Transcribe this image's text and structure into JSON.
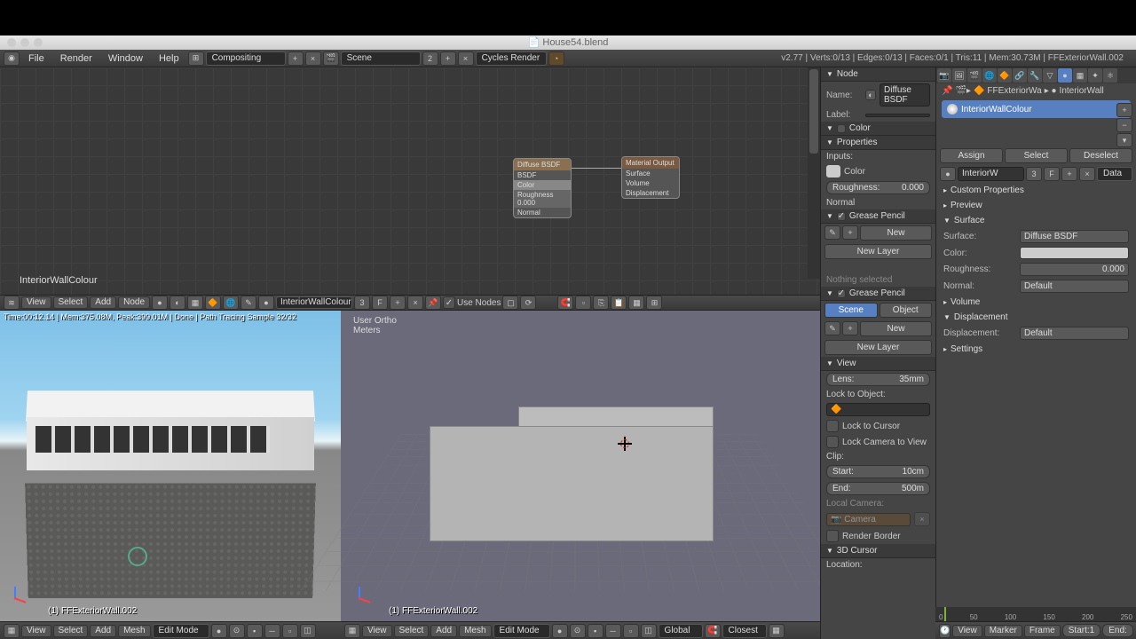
{
  "title": "House54.blend",
  "topmenu": {
    "file": "File",
    "render": "Render",
    "window": "Window",
    "help": "Help",
    "layout": "Compositing",
    "scene": "Scene",
    "engine": "Cycles Render",
    "stats": "v2.77 | Verts:0/13 | Edges:0/13 | Faces:0/1 | Tris:11 | Mem:30.73M | FFExteriorWall.002"
  },
  "node_editor": {
    "material_label": "InteriorWallColour",
    "node1_title": "Diffuse BSDF",
    "node1_color": "Color",
    "node1_rough": "Roughness 0.000",
    "node2_title": "Material Output",
    "node2_surface": "Surface",
    "node2_volume": "Volume",
    "node2_disp": "Displacement"
  },
  "node_header": {
    "view": "View",
    "select": "Select",
    "add": "Add",
    "node": "Node",
    "material": "InteriorWallColour",
    "use_nodes": "Use Nodes",
    "f": "F"
  },
  "render_view": {
    "stats": "Time:00:12.14 | Mem:375.08M, Peak:399.01M | Done | Path Tracing Sample 32/32",
    "object": "(1) FFExteriorWall.002"
  },
  "edit_view": {
    "proj": "User Ortho",
    "units": "Meters",
    "object": "(1) FFExteriorWall.002"
  },
  "footer_left": {
    "view": "View",
    "select": "Select",
    "add": "Add",
    "mesh": "Mesh",
    "mode": "Edit Mode"
  },
  "footer_right": {
    "view": "View",
    "select": "Select",
    "add": "Add",
    "mesh": "Mesh",
    "mode": "Edit Mode",
    "global": "Global"
  },
  "npanel": {
    "node_hdr": "Node",
    "name_lbl": "Name:",
    "name_val": "Diffuse BSDF",
    "label_lbl": "Label:",
    "label_val": "",
    "color_hdr": "Color",
    "props_hdr": "Properties",
    "inputs": "Inputs:",
    "color_inp": "Color",
    "rough_lbl": "Roughness:",
    "rough_val": "0.000",
    "normal": "Normal",
    "gp_hdr": "Grease Pencil",
    "new": "New",
    "newlayer": "New Layer",
    "nothing": "Nothing selected",
    "scene": "Scene",
    "object": "Object",
    "view_hdr": "View",
    "lens_lbl": "Lens:",
    "lens_val": "35mm",
    "lock_obj": "Lock to Object:",
    "lock_cursor": "Lock to Cursor",
    "lock_cam": "Lock Camera to View",
    "clip": "Clip:",
    "start_lbl": "Start:",
    "start_val": "10cm",
    "end_lbl": "End:",
    "end_val": "500m",
    "local_cam": "Local Camera:",
    "camera": "Camera",
    "render_border": "Render Border",
    "cursor_hdr": "3D Cursor",
    "location": "Location:"
  },
  "props": {
    "breadcrumb_obj": "FFExteriorWa",
    "breadcrumb_mat": "InteriorWall",
    "mat_name": "InteriorWallColour",
    "assign": "Assign",
    "select": "Select",
    "deselect": "Deselect",
    "mat_field": "InteriorW",
    "n": "3",
    "f": "F",
    "data": "Data",
    "custom_hdr": "Custom Properties",
    "preview_hdr": "Preview",
    "surface_hdr": "Surface",
    "surface_lbl": "Surface:",
    "surface_val": "Diffuse BSDF",
    "color_lbl": "Color:",
    "rough_lbl": "Roughness:",
    "rough_val": "0.000",
    "normal_lbl": "Normal:",
    "normal_val": "Default",
    "volume_hdr": "Volume",
    "disp_hdr": "Displacement",
    "disp_lbl": "Displacement:",
    "disp_val": "Default",
    "settings_hdr": "Settings"
  },
  "timeline": {
    "view": "View",
    "marker": "Marker",
    "frame": "Frame",
    "start_lbl": "Start:",
    "start_val": "1",
    "end": "End:",
    "closest": "Closest",
    "ticks": [
      "0",
      "50",
      "100",
      "150",
      "200",
      "250"
    ]
  }
}
